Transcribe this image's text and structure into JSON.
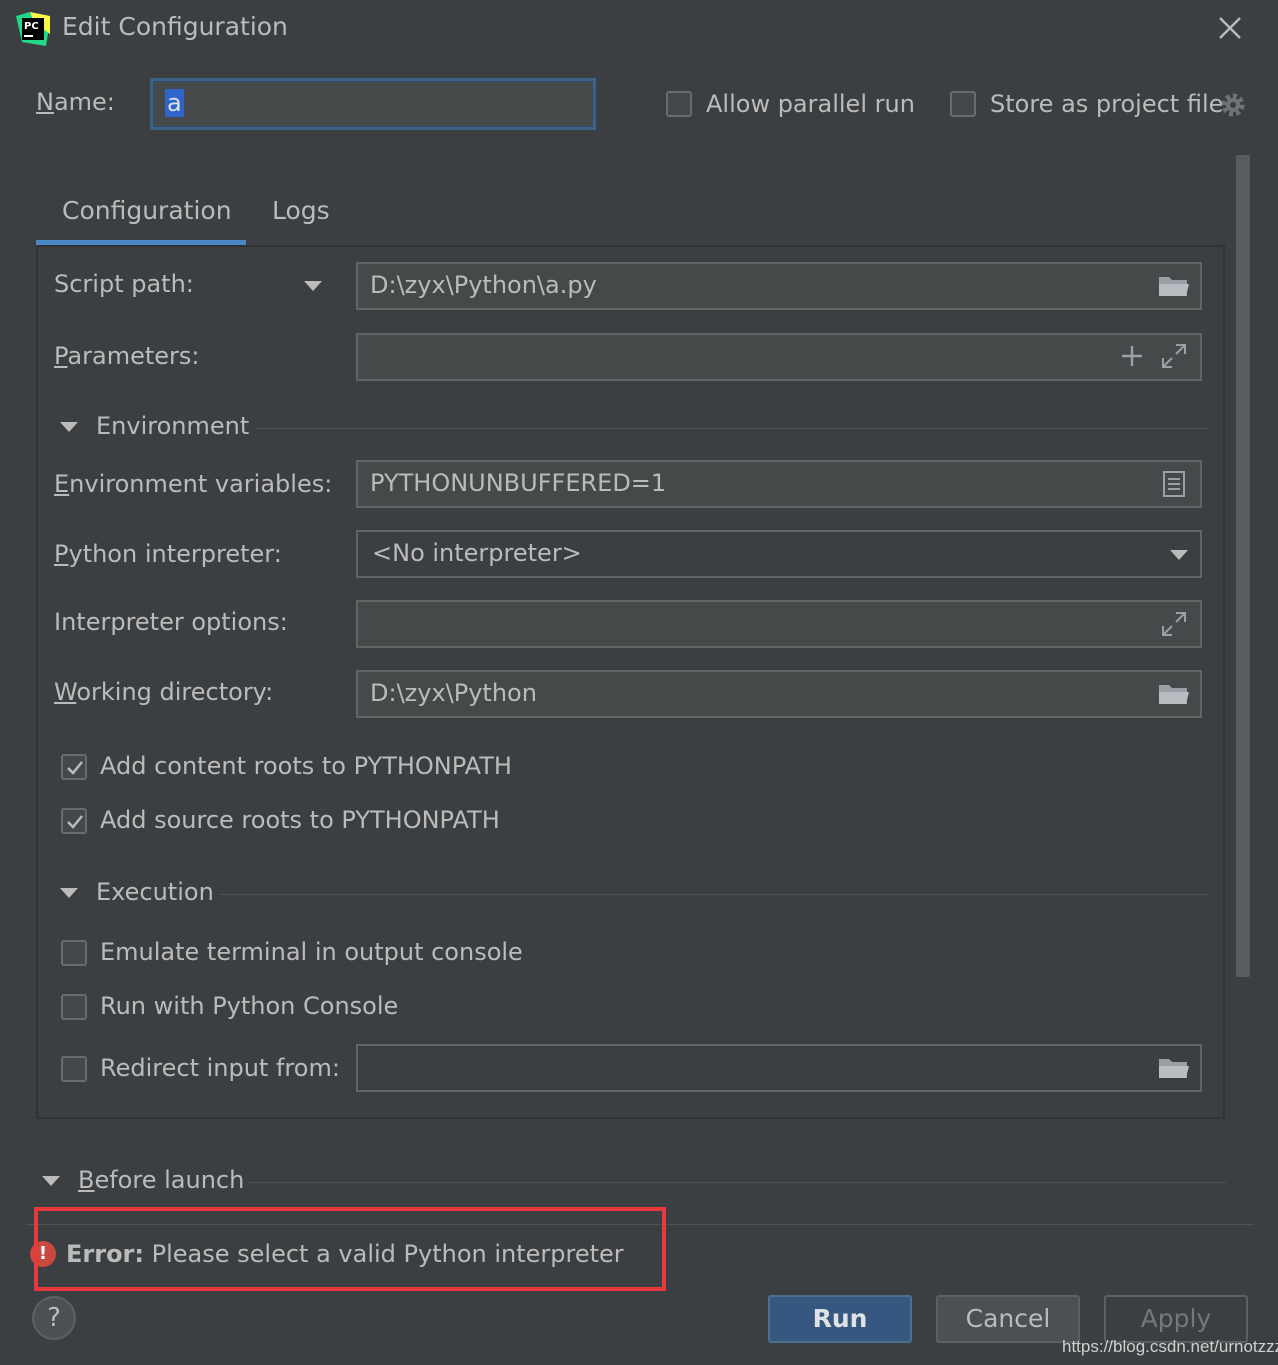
{
  "window": {
    "title": "Edit Configuration",
    "app_icon": "pycharm-logo"
  },
  "header": {
    "name_label": "Name:",
    "name_value": "a",
    "allow_parallel_label": "Allow parallel run",
    "allow_parallel_checked": false,
    "store_project_label": "Store as project file",
    "store_project_checked": false
  },
  "tabs": [
    {
      "label": "Configuration",
      "active": true
    },
    {
      "label": "Logs",
      "active": false
    }
  ],
  "form": {
    "script_path_label": "Script path:",
    "script_path_value": "D:\\zyx\\Python\\a.py",
    "parameters_label": "Parameters:",
    "parameters_value": "",
    "environment_section": "Environment",
    "env_vars_label": "Environment variables:",
    "env_vars_value": "PYTHONUNBUFFERED=1",
    "interpreter_label": "Python interpreter:",
    "interpreter_value": "<No interpreter>",
    "interp_options_label": "Interpreter options:",
    "interp_options_value": "",
    "working_dir_label": "Working directory:",
    "working_dir_value": "D:\\zyx\\Python",
    "content_roots_label": "Add content roots to PYTHONPATH",
    "content_roots_checked": true,
    "source_roots_label": "Add source roots to PYTHONPATH",
    "source_roots_checked": true,
    "execution_section": "Execution",
    "emulate_terminal_label": "Emulate terminal in output console",
    "emulate_terminal_checked": false,
    "python_console_label": "Run with Python Console",
    "python_console_checked": false,
    "redirect_input_label": "Redirect input from:",
    "redirect_input_checked": false,
    "redirect_input_value": ""
  },
  "before_launch": {
    "label": "Before launch"
  },
  "error": {
    "prefix": "Error:",
    "message": "Please select a valid Python interpreter",
    "highlight_color": "#e8393c"
  },
  "footer": {
    "help_label": "?",
    "run_label": "Run",
    "cancel_label": "Cancel",
    "apply_label": "Apply"
  },
  "watermark": "https://blog.csdn.net/urnotzzz",
  "colors": {
    "background": "#3c3f41",
    "accent": "#4a88c7",
    "run_button": "#365880"
  }
}
